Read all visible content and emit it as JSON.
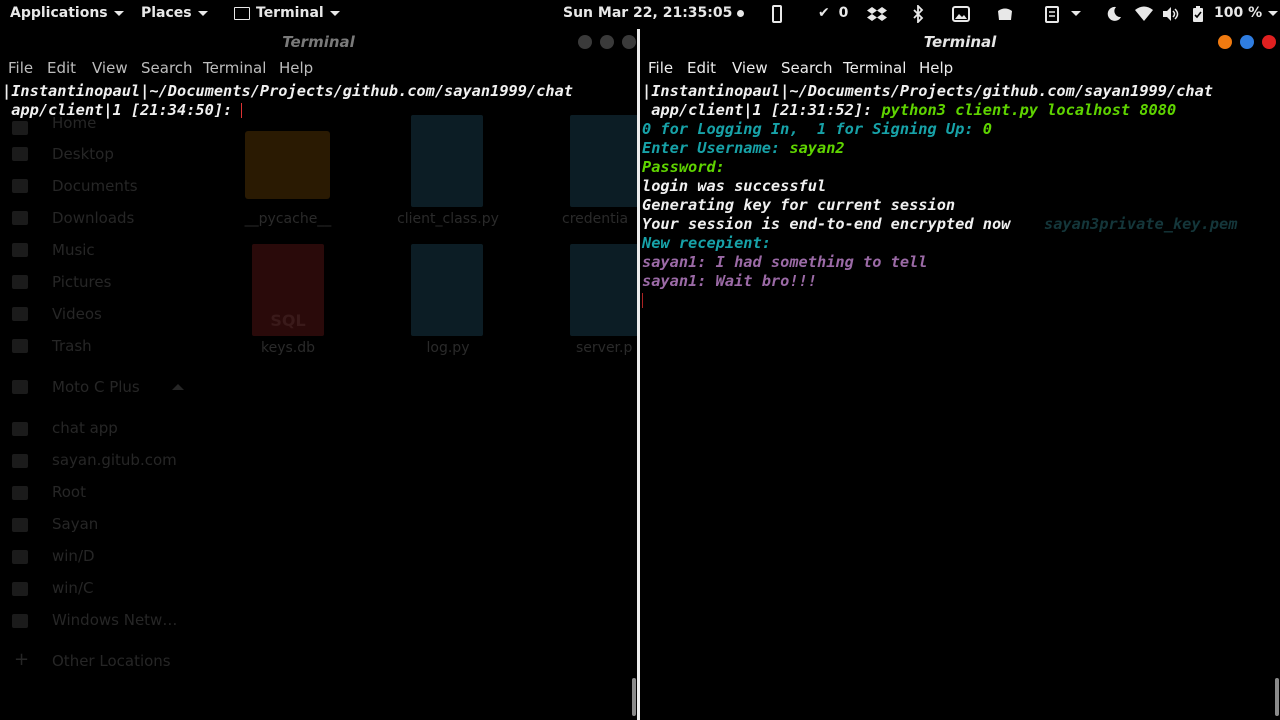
{
  "topbar": {
    "applications": "Applications",
    "places": "Places",
    "app": "Terminal",
    "clock": "Sun Mar 22, 21:35:05",
    "updates_count": "0",
    "battery": "100 %"
  },
  "left_window": {
    "title": "Terminal",
    "menu": [
      "File",
      "Edit",
      "View",
      "Search",
      "Terminal",
      "Help"
    ],
    "prompt_line1": "|Instantinopaul|~/Documents/Projects/github.com/sayan1999/chat",
    "prompt_line2": " app/client|1 [21:34:50]: "
  },
  "right_window": {
    "title": "Terminal",
    "menu": [
      "File",
      "Edit",
      "View",
      "Search",
      "Terminal",
      "Help"
    ],
    "prompt_line1": "|Instantinopaul|~/Documents/Projects/github.com/sayan1999/chat",
    "prompt_line2": " app/client|1 [21:31:52]: ",
    "command": "python3 client.py localhost 8080",
    "login_prompt": "0 for Logging In,  1 for Signing Up: ",
    "login_choice": "0",
    "username_prompt": "Enter Username: ",
    "username": "sayan2",
    "password_prompt": "Password:",
    "login_result": "login was successful",
    "keygen": "Generating key for current session",
    "encrypted": "Your session is end-to-end encrypted now",
    "ghost_file": "sayan3private_key.pem",
    "recipient_prompt": "New recepient:",
    "messages": [
      "sayan1: I had something to tell",
      "sayan1: Wait bro!!!"
    ]
  },
  "file_manager": {
    "sidebar": [
      "Home",
      "Desktop",
      "Documents",
      "Downloads",
      "Music",
      "Pictures",
      "Videos",
      "Trash",
      "Moto C Plus",
      "chat app",
      "sayan.gitub.com",
      "Root",
      "Sayan",
      "win/D",
      "win/C",
      "Windows Netw…",
      "Other Locations"
    ],
    "files": [
      "__pycache__",
      "client_class.py",
      "credentia",
      "keys.db",
      "log.py",
      "server.p"
    ],
    "sql_label": "SQL"
  },
  "colors": {
    "prompt_cyan": "#17a2a8",
    "command_green": "#5fd400",
    "message_purple": "#9b6aa6",
    "close_red": "#e02020",
    "max_blue": "#2f7de0",
    "min_orange": "#f07a10"
  }
}
